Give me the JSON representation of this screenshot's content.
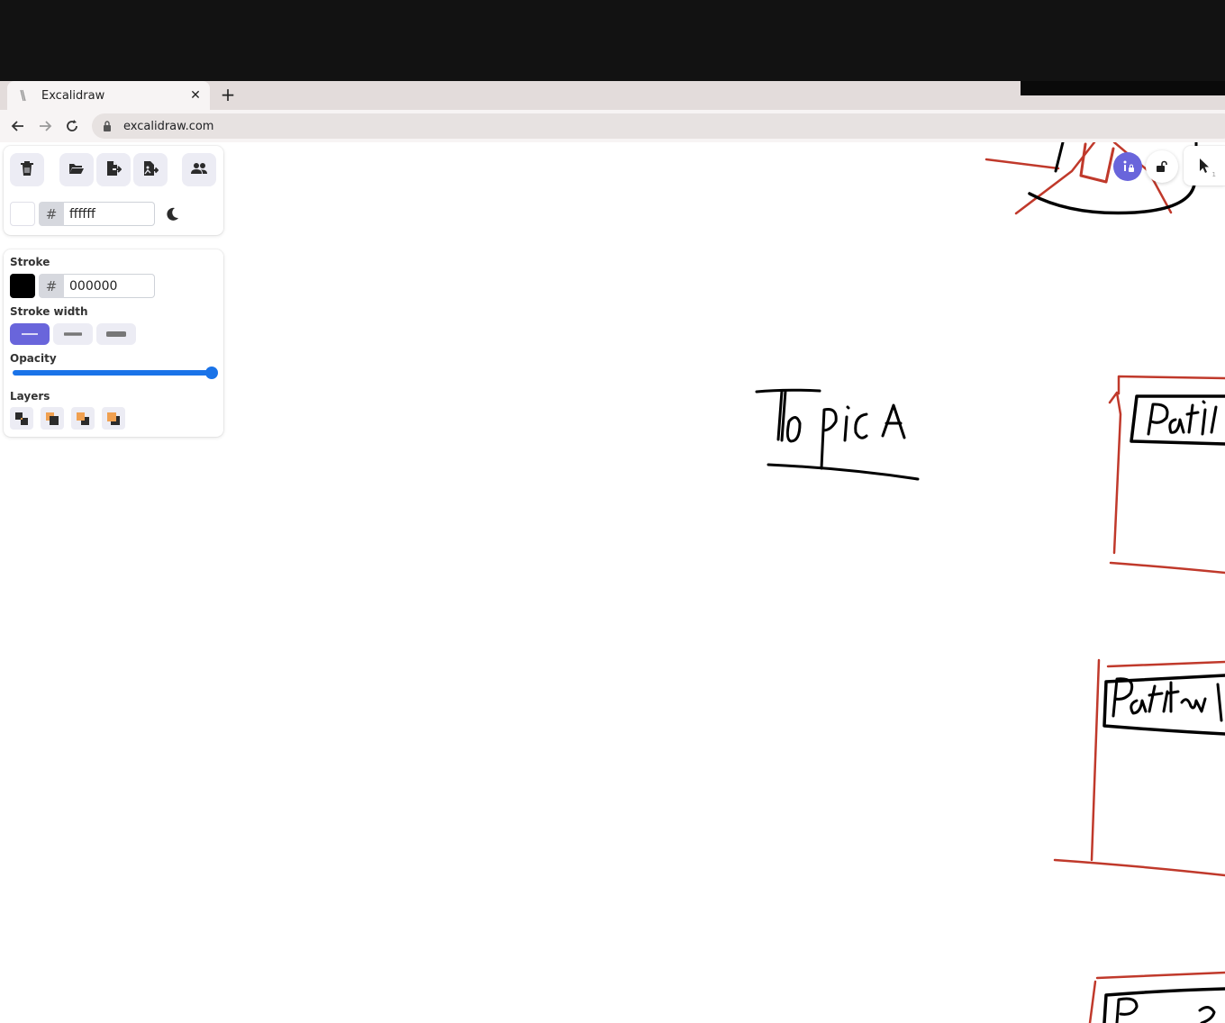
{
  "browser": {
    "tab_title": "Excalidraw",
    "tab_close": "✕",
    "new_tab": "+",
    "url": "excalidraw.com"
  },
  "toolbar": {
    "clear_canvas": "trash-icon",
    "open": "folder-open-icon",
    "save_to": "file-export-icon",
    "export_image": "image-export-icon",
    "live_collaboration": "users-icon"
  },
  "canvas_background": {
    "hash": "#",
    "value": "ffffff",
    "theme_toggle": "moon-icon"
  },
  "properties": {
    "stroke_label": "Stroke",
    "stroke_hash": "#",
    "stroke_value": "000000",
    "stroke_width_label": "Stroke width",
    "stroke_widths": [
      "thin",
      "bold",
      "extra-bold"
    ],
    "stroke_width_selected": "thin",
    "opacity_label": "Opacity",
    "opacity_value": 100,
    "layers_label": "Layers"
  },
  "top_right": {
    "pointer_key": "1"
  },
  "colors": {
    "accent": "#6965db",
    "slider": "#1a73e8",
    "stroke_black": "#000000",
    "sketch_red": "#c0392b"
  },
  "sketch_text": {
    "topic": "Topic A"
  }
}
